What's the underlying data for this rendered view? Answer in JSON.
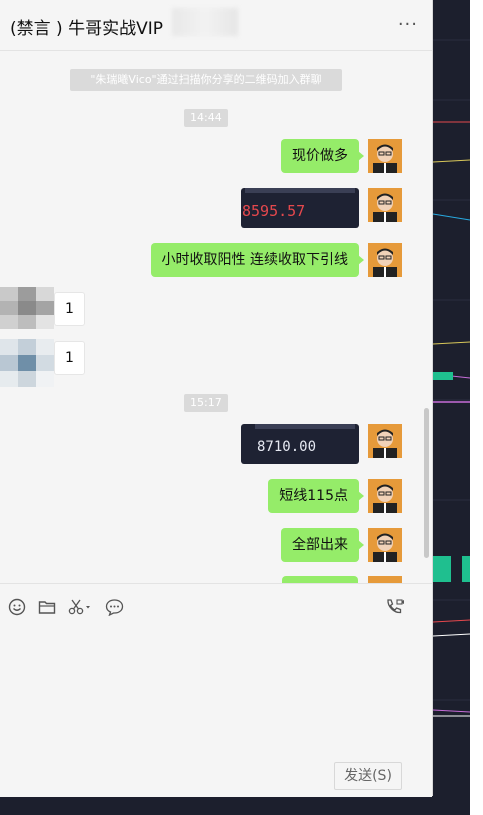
{
  "header": {
    "title": "(禁言 ) 牛哥实战VIP",
    "more_label": "···"
  },
  "messages": {
    "system_notice": "\"朱瑞曦Vico\"通过扫描你分享的二维码加入群聊",
    "time1": "14:44",
    "msg1": "现价做多",
    "img1_value": "8595.57",
    "msg2": "小时收取阳性 连续收取下引线",
    "reply1": "1",
    "reply2": "1",
    "time2": "15:17",
    "img2_value": "8710.00",
    "msg3": "短线115点",
    "msg4": "全部出来"
  },
  "toolbar": {
    "emoji_icon": "emoji-icon",
    "folder_icon": "folder-icon",
    "scissors_icon": "scissors-icon",
    "chat_icon": "chat-bubble-icon",
    "call_icon": "video-call-icon"
  },
  "send": {
    "label": "发送(S)"
  },
  "colors": {
    "bubble_green": "#95ec69",
    "chart_red": "#e5484d",
    "chart_green": "#1fbf8f"
  }
}
